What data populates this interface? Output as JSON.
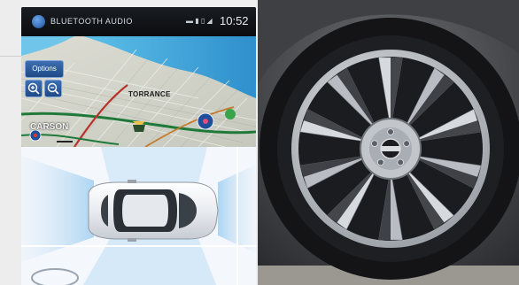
{
  "nav_screen": {
    "source_label": "BLUETOOTH AUDIO",
    "clock": "10:52",
    "options_label": "Options",
    "map_labels": {
      "torrance": "TORRANCE",
      "carson": "CARSON"
    }
  },
  "icons": {
    "bluetooth_source": "bluetooth-audio-icon",
    "zoom_in": "zoom-in-icon",
    "zoom_out": "zoom-out-icon",
    "wheel_badge": "nissan-badge"
  },
  "colors": {
    "screen_background": "#0d0f12",
    "map_water": "#3fa9dc",
    "button_blue": "#2c5ea0",
    "tire_black": "#151516",
    "rim_silver": "#c9cdd2",
    "rim_black": "#1c1d20",
    "sensor_beam": "#a9d3f2"
  }
}
